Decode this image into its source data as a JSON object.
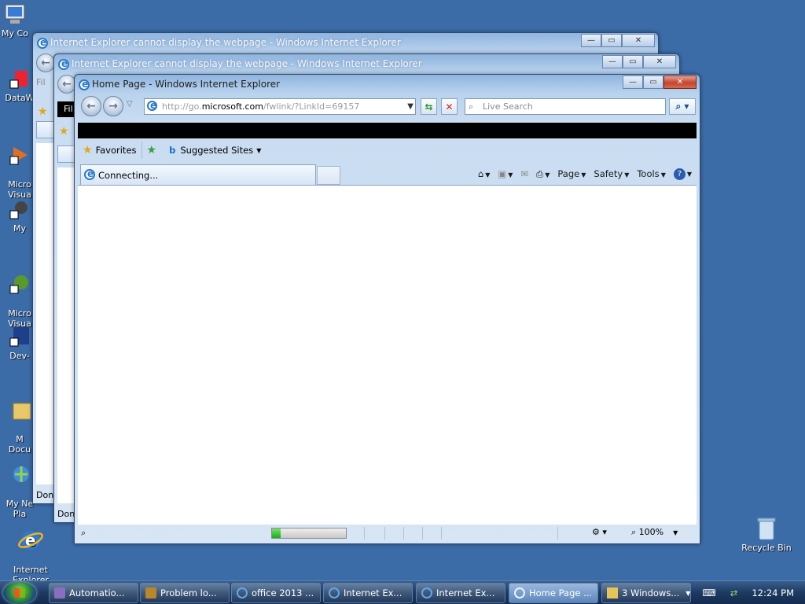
{
  "desktop": {
    "icons": [
      {
        "label": "My Co",
        "name": "my-computer"
      },
      {
        "label": "DataW",
        "name": "dataw"
      },
      {
        "label": "Micro\nVisua",
        "name": "micro-visua-1"
      },
      {
        "label": "My",
        "name": "my"
      },
      {
        "label": "Micro\nVisua",
        "name": "micro-visua-2"
      },
      {
        "label": "Dev-",
        "name": "dev"
      },
      {
        "label": "M\nDocu",
        "name": "my-documents"
      },
      {
        "label": "My Ne\nPla",
        "name": "my-network-places"
      },
      {
        "label": "Internet\nExplorer",
        "name": "internet-explorer"
      },
      {
        "label": "Recycle Bin",
        "name": "recycle-bin"
      }
    ]
  },
  "back_window_1": {
    "title": "Internet Explorer cannot display the webpage - Windows Internet Explorer",
    "menu_peek": "Fil",
    "status": "Don"
  },
  "back_window_2": {
    "title": "Internet Explorer cannot display the webpage - Windows Internet Explorer",
    "menu_peek": "Fil",
    "status": "Don"
  },
  "main_window": {
    "title": "Home Page - Windows Internet Explorer",
    "address": {
      "prefix": "http://go.",
      "domain": "microsoft.com",
      "suffix": "/fwlink/?LinkId=69157"
    },
    "search_placeholder": "Live Search",
    "favorites_label": "Favorites",
    "suggested_sites_label": "Suggested Sites",
    "tab_label": "Connecting...",
    "commands": {
      "page": "Page",
      "safety": "Safety",
      "tools": "Tools"
    },
    "status": {
      "progress": 0.12,
      "zoom": "100%"
    }
  },
  "taskbar": {
    "buttons": [
      {
        "label": "Automatio...",
        "name": "taskbar-automation"
      },
      {
        "label": "Problem lo...",
        "name": "taskbar-problem"
      },
      {
        "label": "office 2013 ...",
        "name": "taskbar-office"
      },
      {
        "label": "Internet Ex...",
        "name": "taskbar-ie-1"
      },
      {
        "label": "Internet Ex...",
        "name": "taskbar-ie-2"
      },
      {
        "label": "Home Page ...",
        "name": "taskbar-home-page"
      },
      {
        "label": "3 Windows...",
        "name": "taskbar-windows-group"
      }
    ],
    "clock": "12:24 PM"
  }
}
